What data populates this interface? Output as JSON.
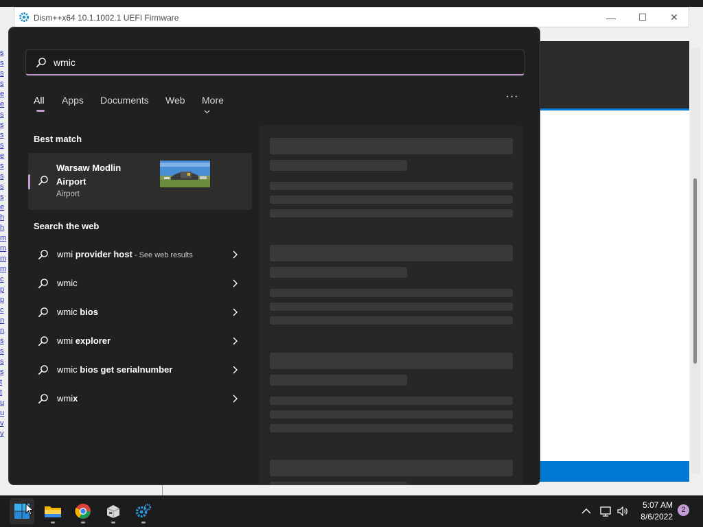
{
  "background_window": {
    "title": "Dism++x64 10.1.1002.1 UEFI Firmware",
    "left_links": [
      "s",
      "s",
      "s",
      "s",
      "e",
      "e",
      "s",
      "s",
      "s",
      "s",
      "e",
      "s",
      "s",
      "s",
      "s",
      "e",
      "h",
      "h",
      "m",
      "m",
      "m",
      "m",
      "c",
      "p",
      "p",
      "c",
      "n",
      "n",
      "s",
      "s",
      "s",
      "s",
      "t",
      "t",
      "u",
      "u",
      "v",
      "v"
    ]
  },
  "search": {
    "query": "wmic",
    "tabs": [
      "All",
      "Apps",
      "Documents",
      "Web",
      "More"
    ],
    "active_tab": "All",
    "more_options_label": "···"
  },
  "best_match": {
    "section_title": "Best match",
    "title": "Warsaw Modlin Airport",
    "subtitle": "Airport"
  },
  "web_search": {
    "section_title": "Search the web",
    "items": [
      {
        "prefix": "wmi ",
        "bold": "provider host",
        "hint": " - See web results"
      },
      {
        "prefix": "wmic",
        "bold": "",
        "hint": ""
      },
      {
        "prefix": "wmic ",
        "bold": "bios",
        "hint": ""
      },
      {
        "prefix": "wmi ",
        "bold": "explorer",
        "hint": ""
      },
      {
        "prefix": "wmic ",
        "bold": "bios get serialnumber",
        "hint": ""
      },
      {
        "prefix": "wmi",
        "bold": "x",
        "hint": ""
      }
    ]
  },
  "taskbar": {
    "apps": [
      "start-button",
      "file-explorer",
      "chrome",
      "package-app",
      "dism-app"
    ],
    "time": "5:07 AM",
    "date": "8/6/2022",
    "notification_count": "2"
  },
  "colors": {
    "accent": "#c39bd3",
    "panel_bg": "#202020",
    "windows_blue": "#0078d4"
  }
}
